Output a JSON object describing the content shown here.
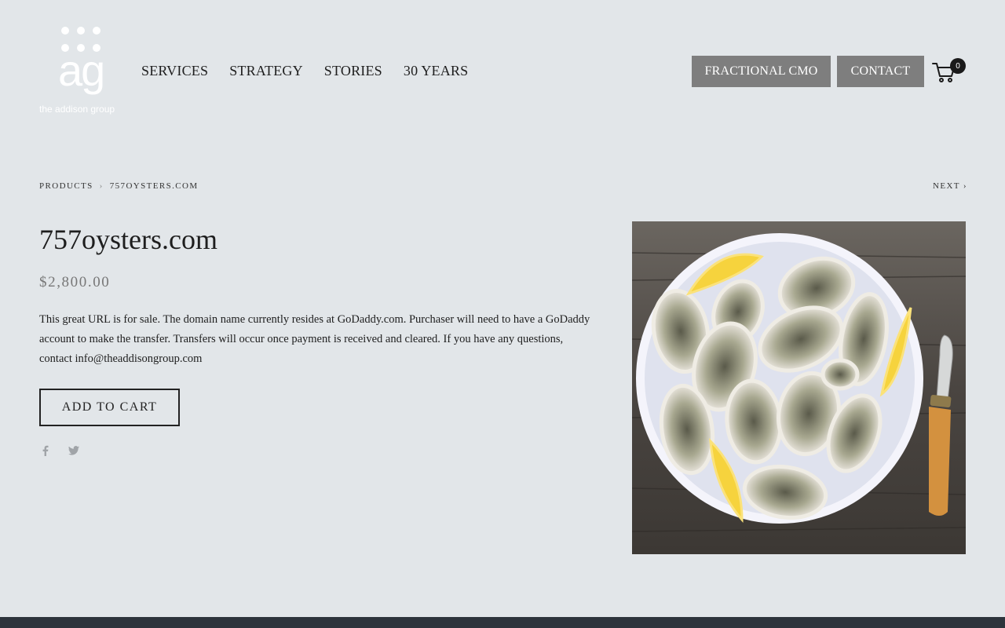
{
  "brand": {
    "logo_text": "ag",
    "tagline": "the addison group"
  },
  "nav": {
    "items": [
      {
        "label": "SERVICES"
      },
      {
        "label": "STRATEGY"
      },
      {
        "label": "STORIES"
      },
      {
        "label": "30 YEARS"
      }
    ]
  },
  "header": {
    "cmo_label": "FRACTIONAL CMO",
    "contact_label": "CONTACT",
    "cart_count": "0"
  },
  "breadcrumb": {
    "parent": "PRODUCTS",
    "separator": "›",
    "current": "757OYSTERS.COM",
    "next_label": "NEXT ›"
  },
  "product": {
    "title": "757oysters.com",
    "price": "$2,800.00",
    "description": "This great URL is for sale.  The domain name currently resides at GoDaddy.com.  Purchaser will need to have a GoDaddy account to make the transfer.  Transfers will occur once payment is received and cleared.  If you have any questions, contact info@theaddisongroup.com",
    "add_to_cart_label": "ADD TO CART"
  },
  "social": {
    "icons": [
      "facebook-icon",
      "twitter-icon"
    ]
  },
  "colors": {
    "background": "#e2e6e9",
    "button_grey": "#7e7e7e",
    "footer": "#2d343c"
  }
}
